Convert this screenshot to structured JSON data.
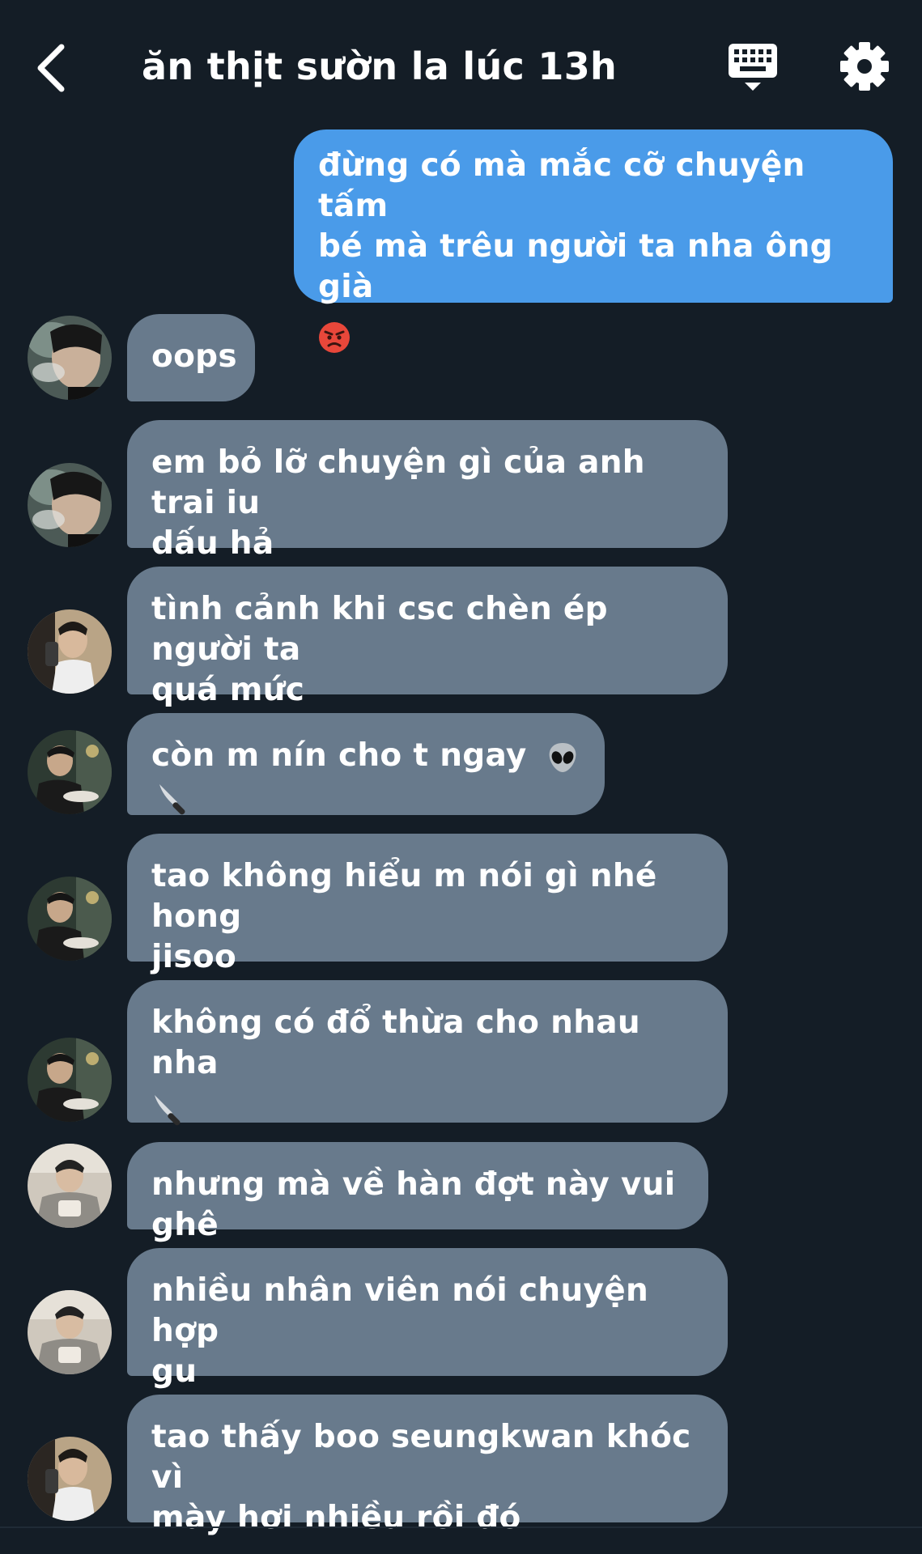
{
  "header": {
    "back_icon": "chevron-left-icon",
    "title": "ăn thịt sườn la lúc 13h",
    "keyboard_icon": "keyboard-icon",
    "settings_icon": "gear-icon"
  },
  "colors": {
    "background": "#141d26",
    "outgoing_bubble": "#4a9be9",
    "incoming_bubble": "#687a8c",
    "text": "#ffffff"
  },
  "messages": [
    {
      "direction": "out",
      "line1": "đừng có mà mắc cỡ chuyện tấm",
      "line2": "bé mà trêu người ta nha ông già",
      "emoji": "angry-face-emoji"
    },
    {
      "direction": "in",
      "avatar": "avatar-a",
      "line1": "oops"
    },
    {
      "direction": "in",
      "avatar": "avatar-a",
      "line1": "em bỏ lỡ chuyện gì của anh trai iu",
      "line2": "dấu hả"
    },
    {
      "direction": "in",
      "avatar": "avatar-b",
      "line1": "tình cảnh khi csc chèn ép người ta",
      "line2": "quá mức"
    },
    {
      "direction": "in",
      "avatar": "avatar-c",
      "line1": "còn m nín cho t ngay",
      "emoji": [
        "alien-emoji",
        "knife-emoji"
      ]
    },
    {
      "direction": "in",
      "avatar": "avatar-c",
      "line1": "tao không hiểu m nói gì nhé hong",
      "line2": "jisoo"
    },
    {
      "direction": "in",
      "avatar": "avatar-c",
      "line1": "không có đổ thừa cho nhau nha",
      "emoji": "knife-emoji"
    },
    {
      "direction": "in",
      "avatar": "avatar-d",
      "line1": "nhưng mà về hàn đợt này vui ghê"
    },
    {
      "direction": "in",
      "avatar": "avatar-d",
      "line1": "nhiều nhân viên nói chuyện hợp",
      "line2": "gu"
    },
    {
      "direction": "in",
      "avatar": "avatar-b",
      "line1": "tao thấy boo seungkwan khóc vì",
      "line2": "mày hơi nhiều rồi đó"
    }
  ]
}
